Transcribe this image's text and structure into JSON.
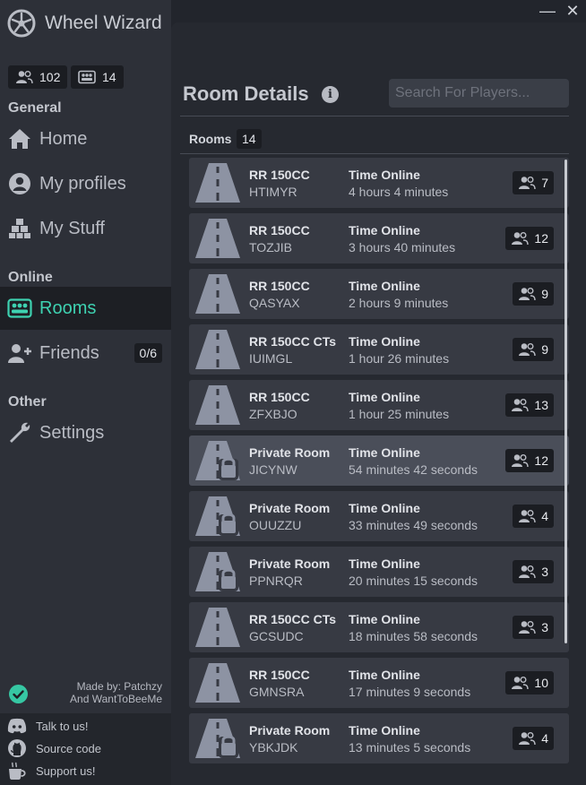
{
  "app": {
    "title": "Wheel Wizard",
    "players_count": "102",
    "rooms_count": "14",
    "minimize_glyph": "—",
    "close_glyph": "✕"
  },
  "sidebar": {
    "sections": [
      {
        "label": "General"
      },
      {
        "label": "Online"
      },
      {
        "label": "Other"
      }
    ],
    "items": [
      {
        "label": "Home",
        "icon": "home-icon"
      },
      {
        "label": "My profiles",
        "icon": "profile-icon"
      },
      {
        "label": "My Stuff",
        "icon": "boxes-icon"
      },
      {
        "label": "Rooms",
        "icon": "rooms-icon"
      },
      {
        "label": "Friends",
        "icon": "add-friend-icon",
        "badge": "0/6"
      },
      {
        "label": "Settings",
        "icon": "wrench-icon"
      }
    ],
    "made_by": [
      "Made by: Patchzy",
      "And WantToBeeMe"
    ],
    "footer_links": [
      {
        "label": "Talk to us!",
        "icon": "discord-icon"
      },
      {
        "label": "Source code",
        "icon": "github-icon"
      },
      {
        "label": "Support us!",
        "icon": "coffee-icon"
      }
    ]
  },
  "main": {
    "title": "Room Details",
    "search_placeholder": "Search For Players...",
    "rooms_label": "Rooms",
    "rooms_count": "14",
    "time_label": "Time Online",
    "rooms": [
      {
        "type": "RR 150CC",
        "code": "HTIMYR",
        "time": "4  hours 4 minutes",
        "players": "7",
        "private": false
      },
      {
        "type": "RR 150CC",
        "code": "TOZJIB",
        "time": "3  hours 40 minutes",
        "players": "12",
        "private": false
      },
      {
        "type": "RR 150CC",
        "code": "QASYAX",
        "time": "2  hours 9 minutes",
        "players": "9",
        "private": false
      },
      {
        "type": "RR 150CC CTs",
        "code": "IUIMGL",
        "time": "1 hour 26 minutes",
        "players": "9",
        "private": false
      },
      {
        "type": "RR 150CC",
        "code": "ZFXBJO",
        "time": "1 hour 25 minutes",
        "players": "13",
        "private": false
      },
      {
        "type": "Private Room",
        "code": "JICYNW",
        "time": "54 minutes 42 seconds",
        "players": "12",
        "private": true,
        "highlighted": true
      },
      {
        "type": "Private Room",
        "code": "OUUZZU",
        "time": "33 minutes 49 seconds",
        "players": "4",
        "private": true
      },
      {
        "type": "Private Room",
        "code": "PPNRQR",
        "time": "20 minutes 15 seconds",
        "players": "3",
        "private": true
      },
      {
        "type": "RR 150CC CTs",
        "code": "GCSUDC",
        "time": "18 minutes 58 seconds",
        "players": "3",
        "private": false
      },
      {
        "type": "RR 150CC",
        "code": "GMNSRA",
        "time": "17 minutes 9 seconds",
        "players": "10",
        "private": false
      },
      {
        "type": "Private Room",
        "code": "YBKJDK",
        "time": "13 minutes 5 seconds",
        "players": "4",
        "private": true
      }
    ]
  },
  "colors": {
    "accent": "#3ed2b1",
    "sidebar_bg": "#2d3038",
    "main_bg": "#262930",
    "card_bg": "#373a43"
  }
}
